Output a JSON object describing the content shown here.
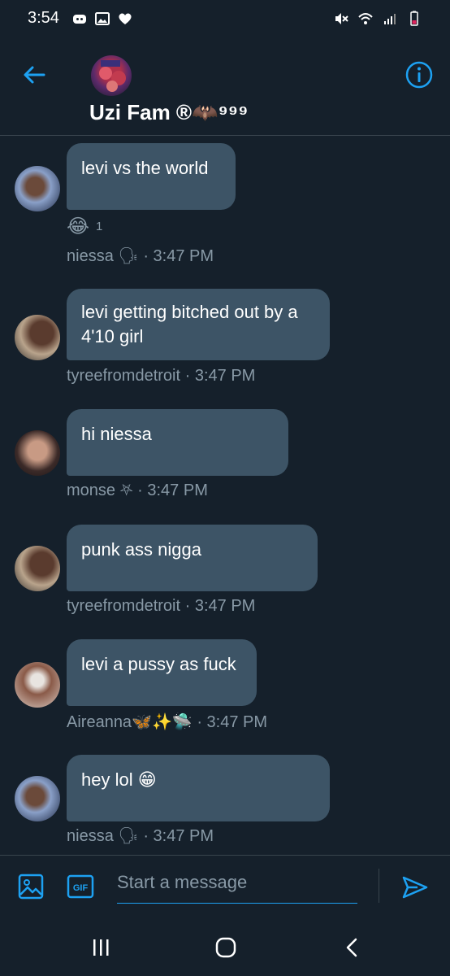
{
  "status": {
    "time": "3:54"
  },
  "header": {
    "title": "Uzi Fam ®🦇⁹⁹⁹"
  },
  "messages": [
    {
      "sender": "niessa 🗣",
      "time": "3:47 PM",
      "text": "levi vs the world",
      "reaction": {
        "emoji": "😂",
        "count": "1"
      }
    },
    {
      "sender": "tyreefromdetroit",
      "time": "3:47 PM",
      "text": "levi getting bitched out by a 4'10 girl"
    },
    {
      "sender": "monse ⛧",
      "time": "3:47 PM",
      "text": "hi niessa"
    },
    {
      "sender": "tyreefromdetroit",
      "time": "3:47 PM",
      "text": "punk ass nigga"
    },
    {
      "sender": "Aireanna🦋✨🛸",
      "time": "3:47 PM",
      "text": "levi a pussy as fuck"
    },
    {
      "sender": "niessa 🗣",
      "time": "3:47 PM",
      "text": "hey lol 😁"
    }
  ],
  "composer": {
    "placeholder": "Start a message"
  },
  "colors": {
    "background": "#15202b",
    "bubble": "#3d5466",
    "accent": "#1da1f2",
    "meta": "#8899a6"
  }
}
